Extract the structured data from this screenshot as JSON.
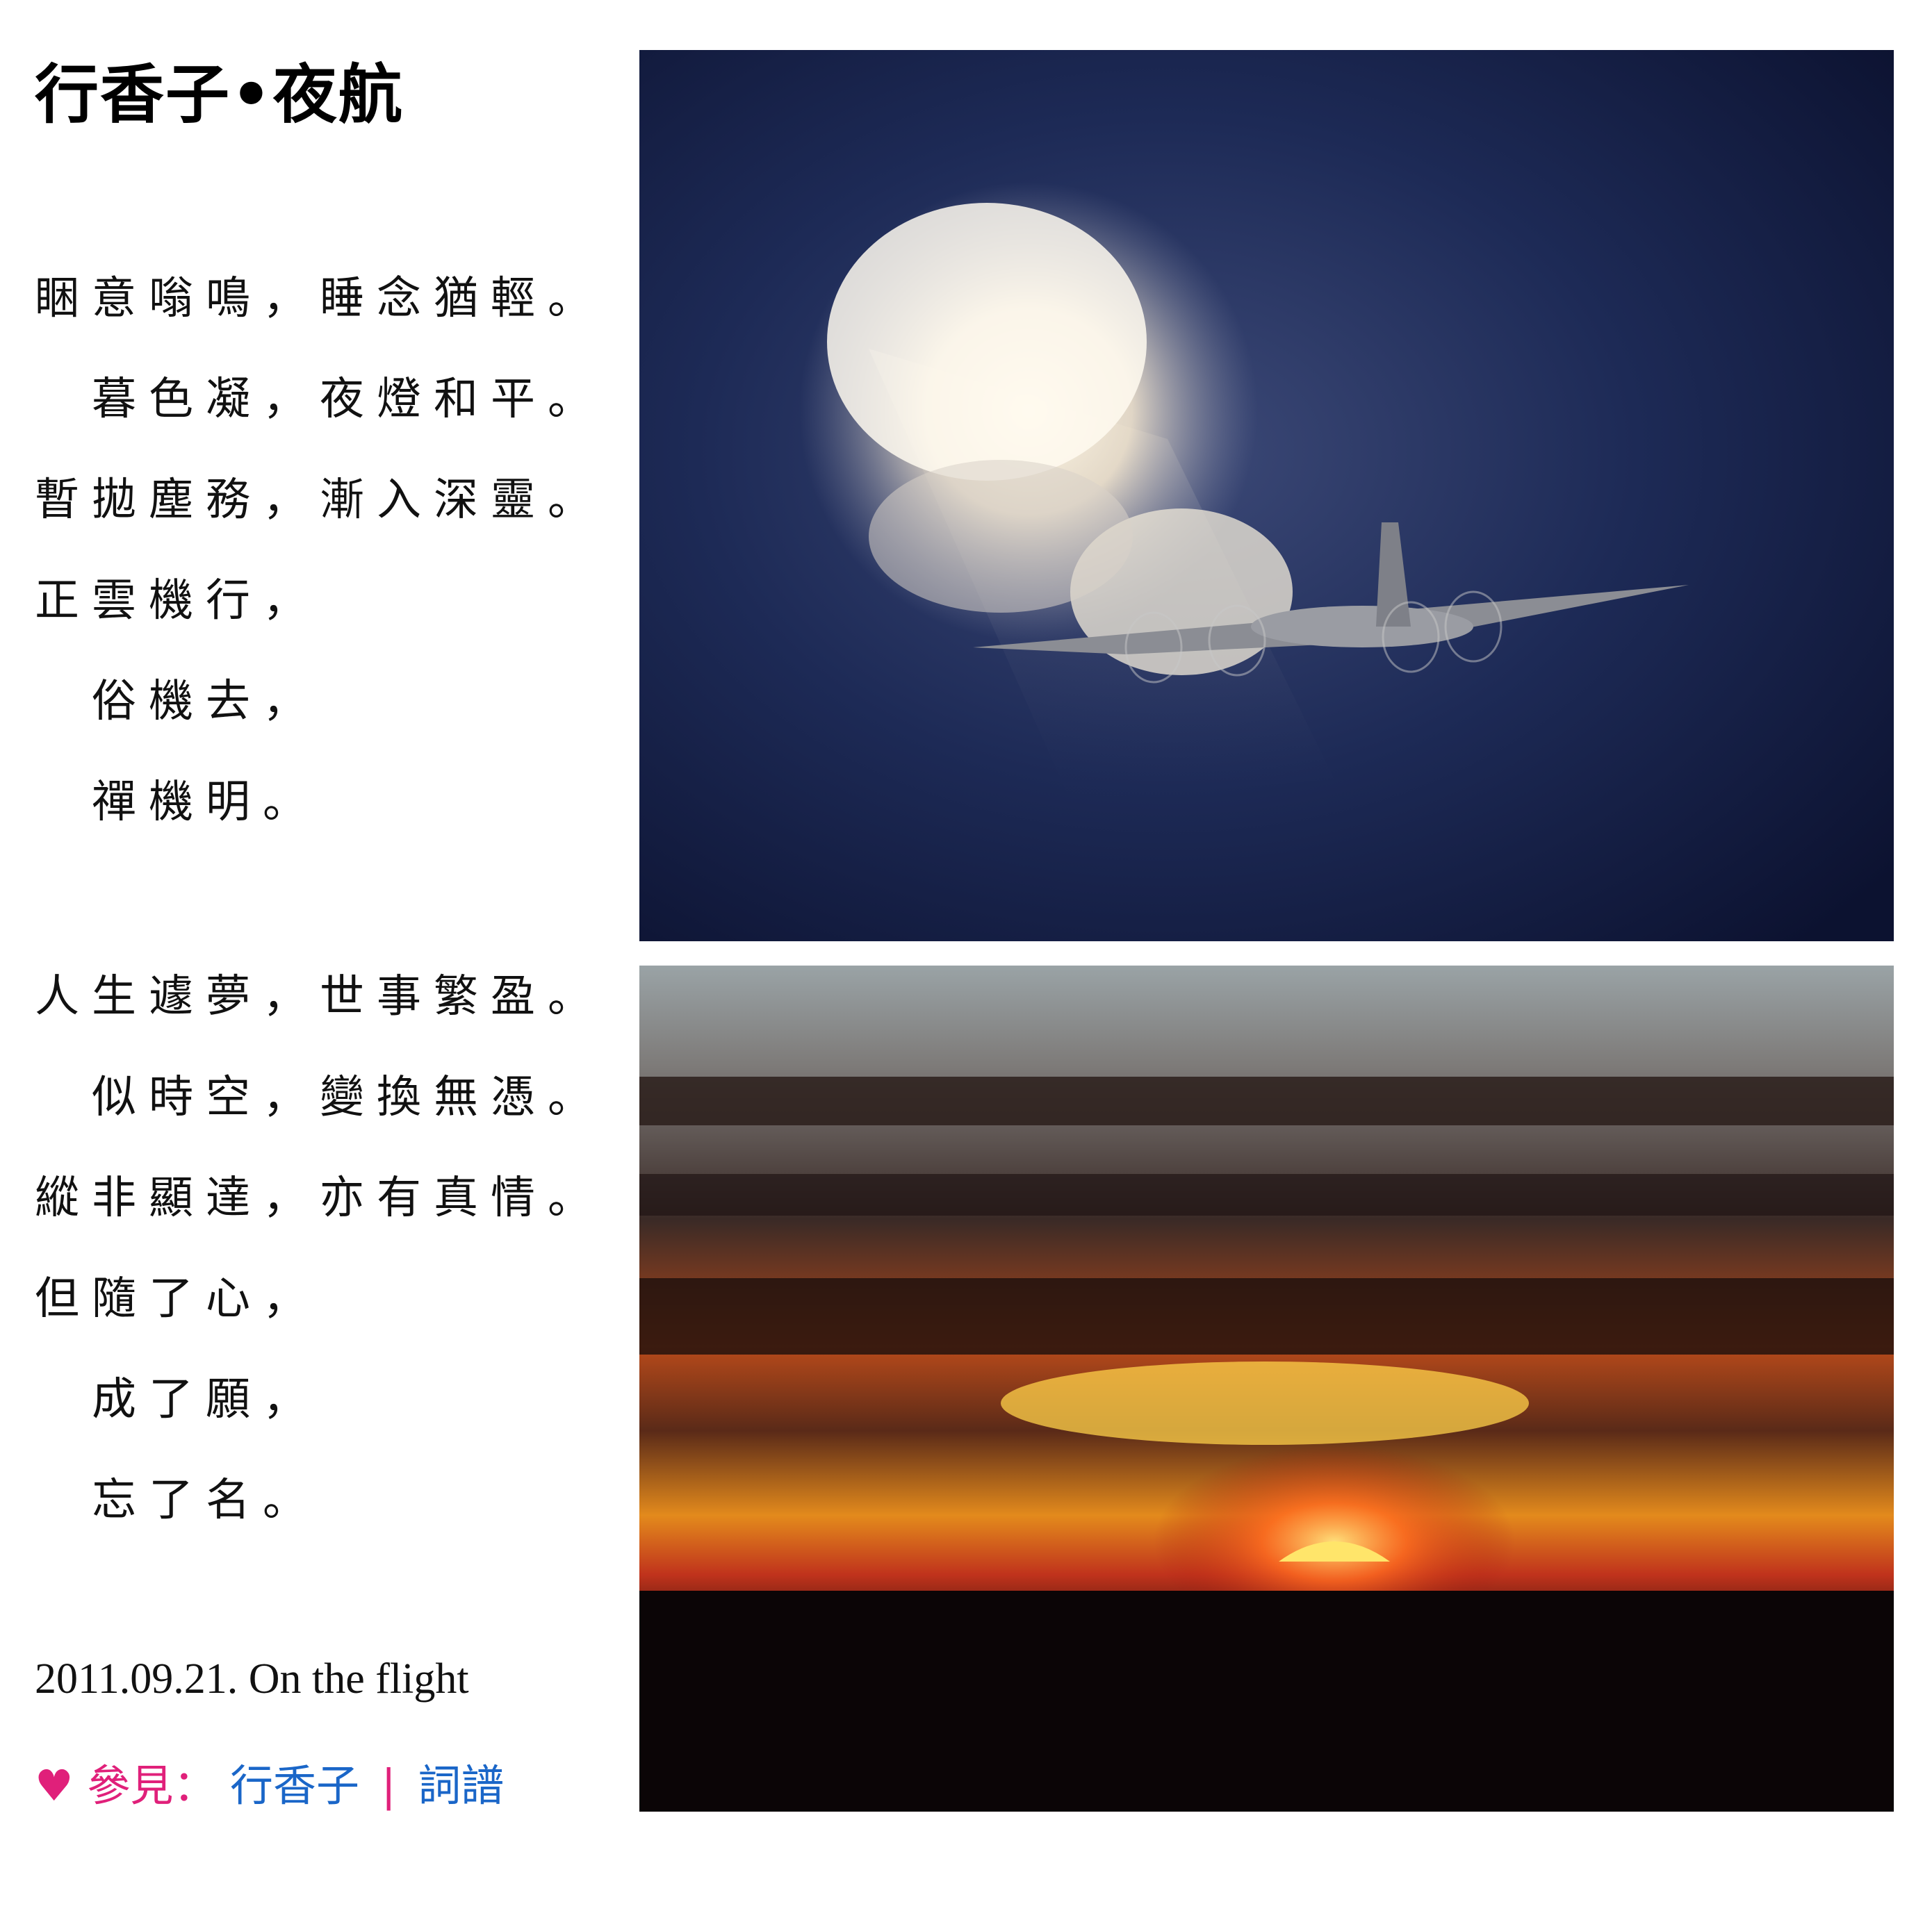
{
  "title": "行香子•夜航",
  "stanza1": [
    {
      "text": "睏意嗡鳴，睡念猶輕。",
      "indent": false
    },
    {
      "text": "暮色凝，夜燈和平。",
      "indent": true
    },
    {
      "text": "暫拋塵務，漸入深靈。",
      "indent": false
    },
    {
      "text": "正雲機行，",
      "indent": false
    },
    {
      "text": "俗機去，",
      "indent": true
    },
    {
      "text": "禪機明。",
      "indent": true
    }
  ],
  "stanza2": [
    {
      "text": "人生遽夢，世事繁盈。",
      "indent": false
    },
    {
      "text": "似時空，變換無憑。",
      "indent": true
    },
    {
      "text": "縱非顯達，亦有真情。",
      "indent": false
    },
    {
      "text": "但隨了心，",
      "indent": false
    },
    {
      "text": "成了願，",
      "indent": true
    },
    {
      "text": "忘了名。",
      "indent": true
    }
  ],
  "date_note": "2011.09.21. On the flight",
  "see_also": {
    "heart": "♥",
    "prefix": "參見：",
    "links": [
      "行香子",
      "詞譜"
    ],
    "separator": "|"
  },
  "images": {
    "top": "night-sky-plane-photo",
    "bottom": "sunset-above-clouds-photo"
  },
  "colors": {
    "link": "#1a66c8",
    "accent": "#e0207a",
    "night_sky": "#1a2448",
    "sunset_orange": "#e8501a"
  }
}
